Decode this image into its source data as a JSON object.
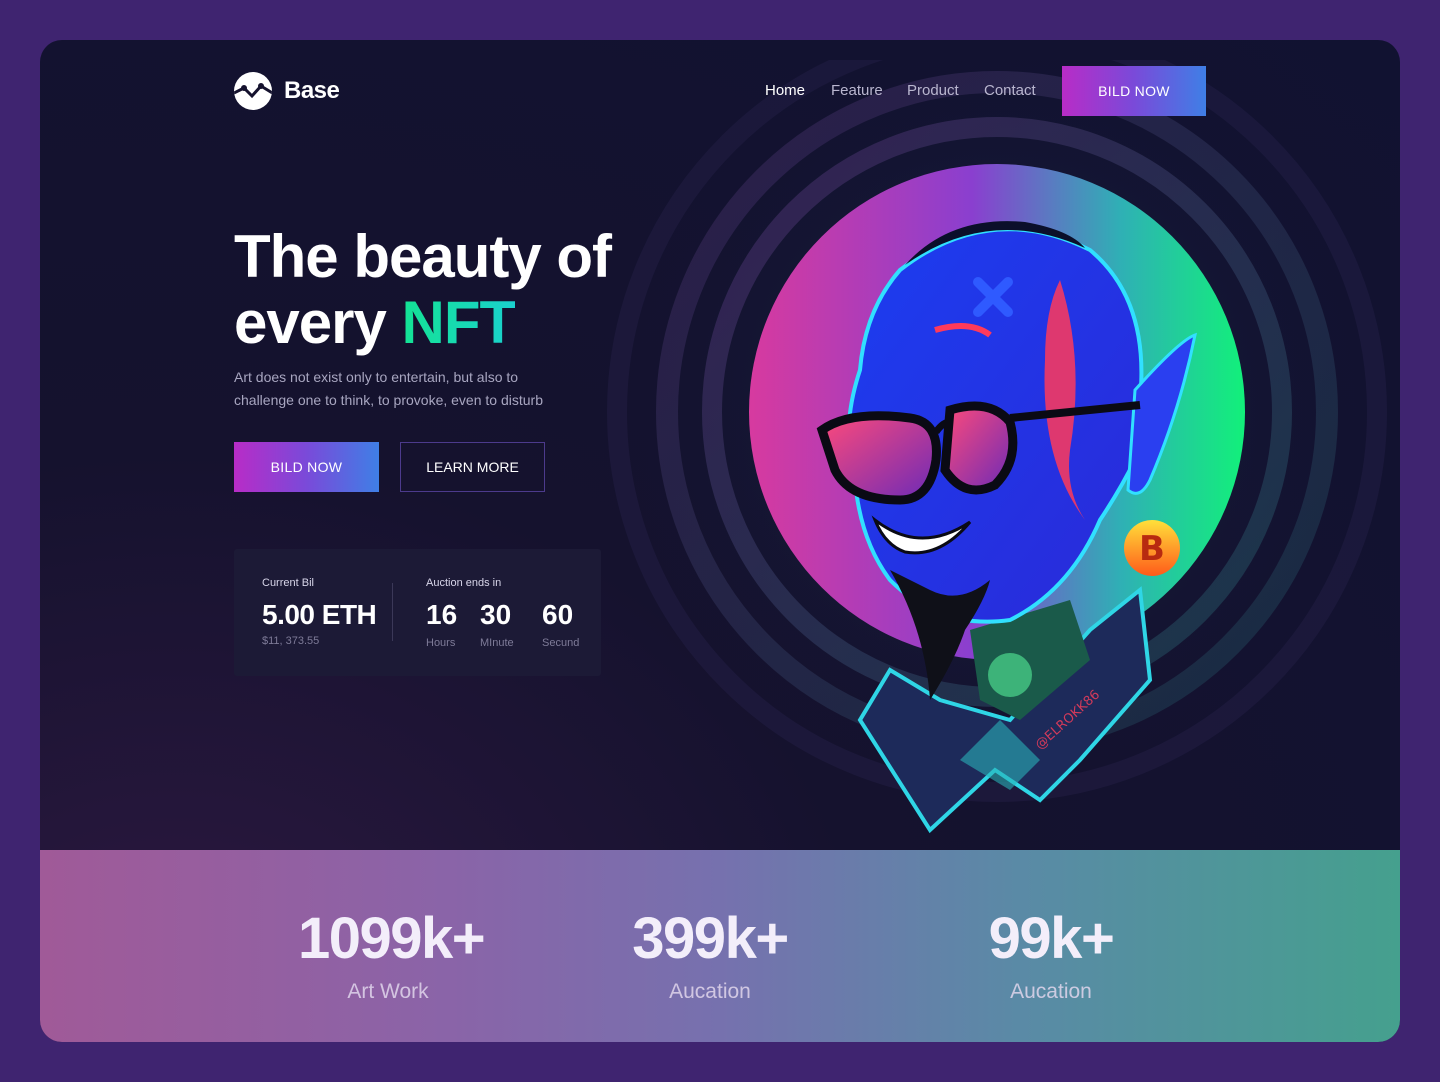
{
  "brand": {
    "name": "Base",
    "icon": "chart-line-icon"
  },
  "nav": {
    "items": [
      "Home",
      "Feature",
      "Product",
      "Contact"
    ],
    "active": "Home",
    "cta_label": "BILD NOW"
  },
  "hero": {
    "title_line1": "The beauty of",
    "title_line2_prefix": "every ",
    "title_accent": "NFT",
    "subtitle": "Art does not exist only to entertain, but also to challenge one to think, to provoke, even to disturb",
    "primary_cta": "BILD NOW",
    "secondary_cta": "LEARN MORE"
  },
  "auction": {
    "current_label": "Current Bil",
    "current_value": "5.00 ETH",
    "current_usd": "$11, 373.55",
    "ends_label": "Auction ends in",
    "hours": "16",
    "hours_label": "Hours",
    "minutes": "30",
    "minutes_label": "MInute",
    "seconds": "60",
    "seconds_label": "Secund"
  },
  "stats": [
    {
      "value": "1099k+",
      "label": "Art Work"
    },
    {
      "value": "399k+",
      "label": "Aucation"
    },
    {
      "value": "99k+",
      "label": "Aucation"
    }
  ],
  "art": {
    "signature": "@ELROKK86",
    "earring": "bitcoin-icon"
  },
  "colors": {
    "page_bg": "#3f2470",
    "frame_bg": "#111231",
    "accent_green": "#14e394",
    "cta_gradient_start": "#b82cc7",
    "cta_gradient_end": "#3f7fe6"
  }
}
